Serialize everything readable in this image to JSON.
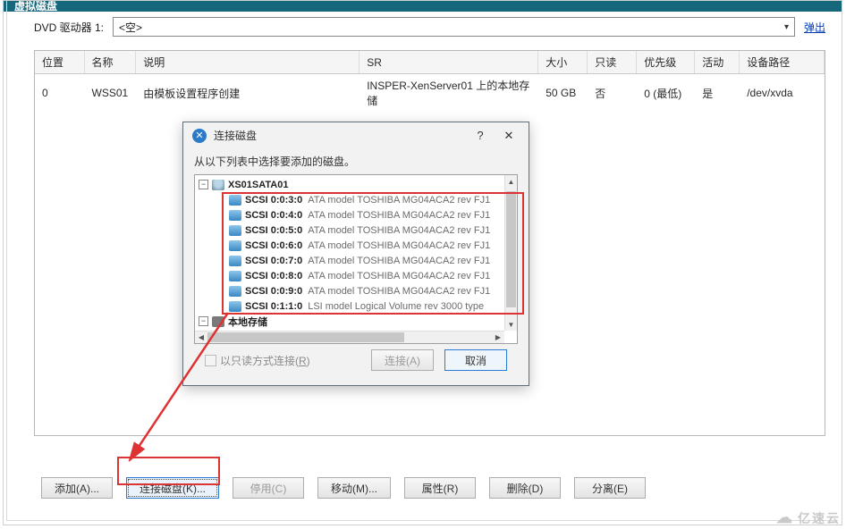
{
  "header": {
    "title": "虚拟磁盘"
  },
  "dvd": {
    "label": "DVD 驱动器 1:",
    "value": "<空>",
    "popout": "弹出"
  },
  "grid": {
    "cols": [
      "位置",
      "名称",
      "说明",
      "SR",
      "大小",
      "只读",
      "优先级",
      "活动",
      "设备路径"
    ],
    "row": {
      "pos": "0",
      "name": "WSS01",
      "desc": "由模板设置程序创建",
      "sr": "INSPER-XenServer01 上的本地存储",
      "size": "50 GB",
      "ro": "否",
      "prio": "0 (最低)",
      "active": "是",
      "dev": "/dev/xvda"
    }
  },
  "dialog": {
    "title": "连接磁盘",
    "hint": "从以下列表中选择要添加的磁盘。",
    "root": "XS01SATA01",
    "disks": [
      {
        "id": "SCSI 0:0:3:0",
        "desc": "ATA model TOSHIBA MG04ACA2 rev FJ1"
      },
      {
        "id": "SCSI 0:0:4:0",
        "desc": "ATA model TOSHIBA MG04ACA2 rev FJ1"
      },
      {
        "id": "SCSI 0:0:5:0",
        "desc": "ATA model TOSHIBA MG04ACA2 rev FJ1"
      },
      {
        "id": "SCSI 0:0:6:0",
        "desc": "ATA model TOSHIBA MG04ACA2 rev FJ1"
      },
      {
        "id": "SCSI 0:0:7:0",
        "desc": "ATA model TOSHIBA MG04ACA2 rev FJ1"
      },
      {
        "id": "SCSI 0:0:8:0",
        "desc": "ATA model TOSHIBA MG04ACA2 rev FJ1"
      },
      {
        "id": "SCSI 0:0:9:0",
        "desc": "ATA model TOSHIBA MG04ACA2 rev FJ1"
      },
      {
        "id": "SCSI 0:1:1:0",
        "desc": "LSI model Logical Volume rev 3000 type"
      }
    ],
    "local": "本地存储",
    "readonly": "以只读方式连接(R)",
    "connect": "连接(A)",
    "cancel": "取消"
  },
  "actions": {
    "add": "添加(A)...",
    "connect": "连接磁盘(K)...",
    "disable": "停用(C)",
    "move": "移动(M)...",
    "props": "属性(R)",
    "delete": "删除(D)",
    "detach": "分离(E)"
  },
  "watermark": "亿速云"
}
